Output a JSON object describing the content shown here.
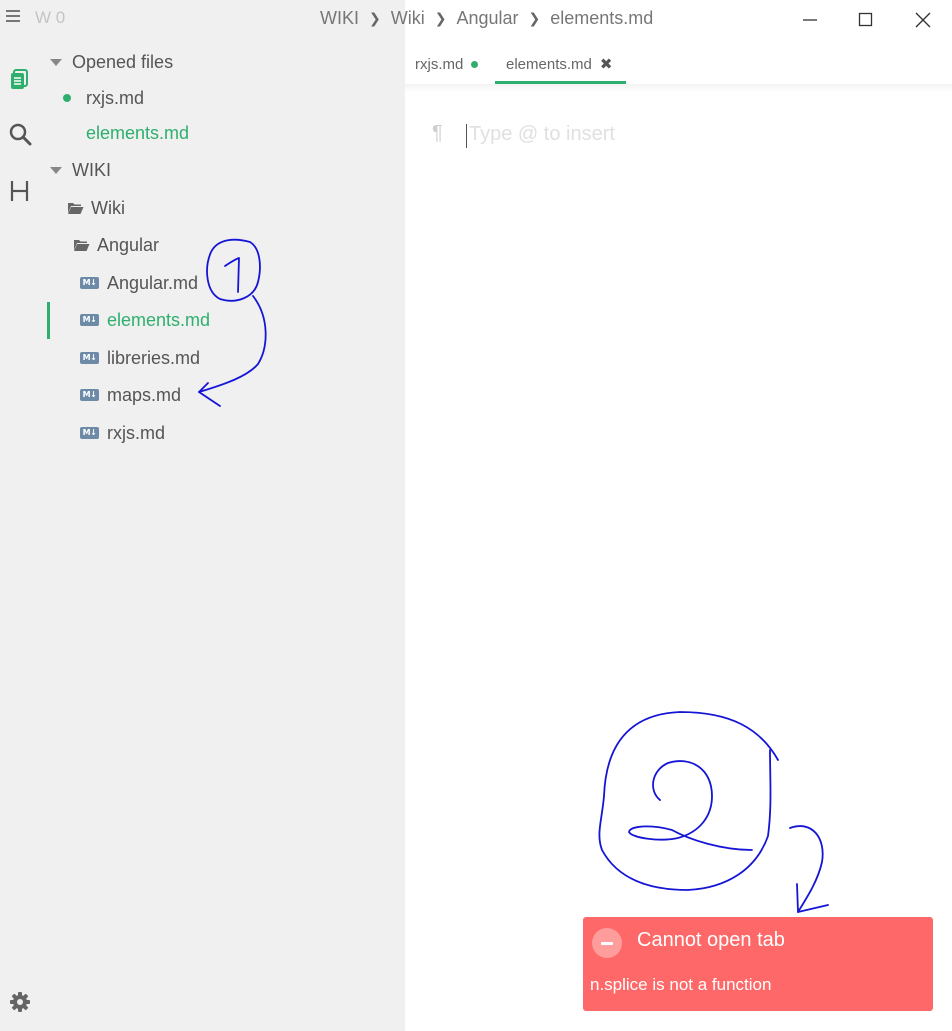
{
  "app": {
    "workspace_count": "W 0"
  },
  "breadcrumb": [
    "WIKI",
    "Wiki",
    "Angular",
    "elements.md"
  ],
  "sidebar": {
    "opened_files_label": "Opened files",
    "opened_files": [
      {
        "name": "rxjs.md",
        "unsaved": true
      },
      {
        "name": "elements.md",
        "active": true
      }
    ],
    "root_label": "WIKI",
    "folders": [
      "Wiki",
      "Angular"
    ],
    "files": [
      "Angular.md",
      "elements.md",
      "libreries.md",
      "maps.md",
      "rxjs.md"
    ],
    "active_file": "elements.md",
    "file_badge": "M↓"
  },
  "tabs": [
    {
      "label": "rxjs.md",
      "unsaved": true
    },
    {
      "label": "elements.md",
      "active": true
    }
  ],
  "editor": {
    "placeholder": "Type @ to insert",
    "pilcrow": "¶"
  },
  "toast": {
    "title": "Cannot open tab",
    "message": "n.splice is not a function"
  },
  "annotations": [
    "1",
    "2"
  ],
  "colors": {
    "accent": "#2eaf6e",
    "error": "#ff6868",
    "sidebar_bg": "#f0f0f0",
    "ink": "#1515d6"
  }
}
